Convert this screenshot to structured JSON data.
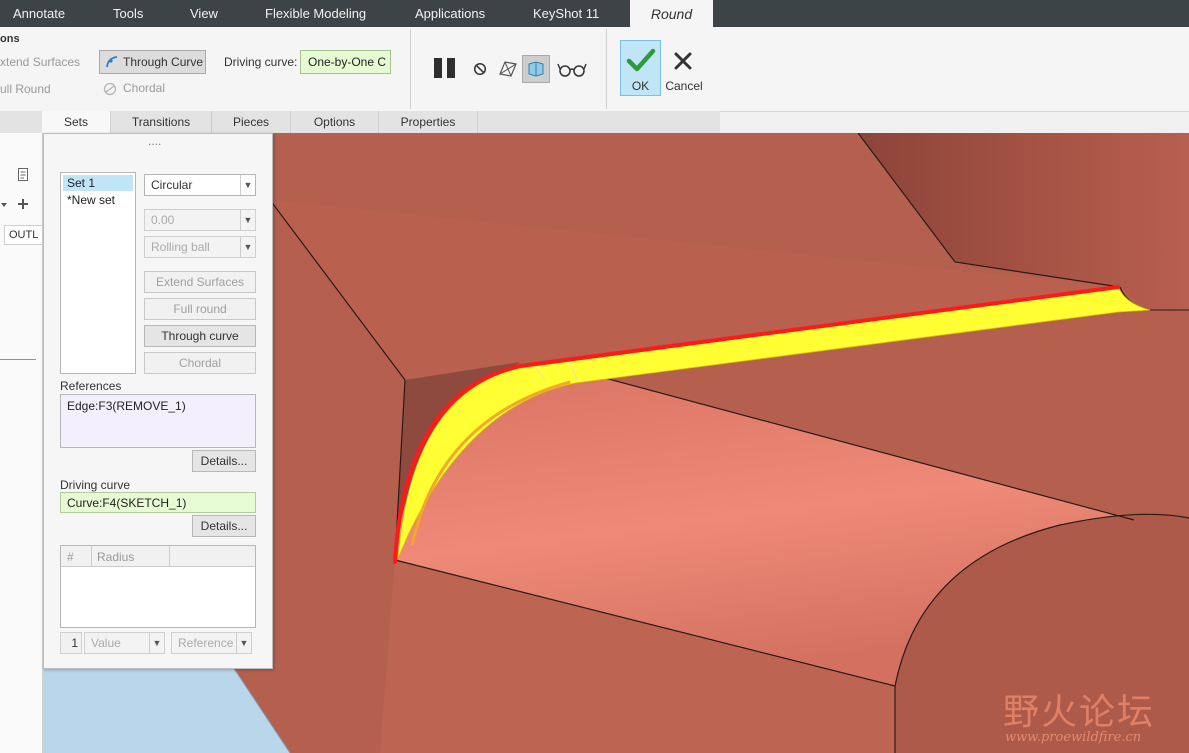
{
  "tabs": [
    "Annotate",
    "Tools",
    "View",
    "Flexible Modeling",
    "Applications",
    "KeyShot 11"
  ],
  "active_tab": "Round",
  "ribbon": {
    "group_title": "ons",
    "extend_surfaces": "xtend Surfaces",
    "full_round": "ull Round",
    "through_curve": "Through Curve",
    "chordal": "Chordal",
    "driving_curve_label": "Driving curve:",
    "driving_curve_value": "One-by-One C",
    "ok": "OK",
    "cancel": "Cancel"
  },
  "subtabs": [
    "Sets",
    "Transitions",
    "Pieces",
    "Options",
    "Properties"
  ],
  "leftstrip": {
    "column": "OUTL"
  },
  "panel": {
    "grip": "....",
    "sets": [
      "Set 1",
      "*New set"
    ],
    "shape": "Circular",
    "value": "0.00",
    "method": "Rolling ball",
    "buttons": {
      "extend": "Extend Surfaces",
      "full_round": "Full round",
      "through_curve": "Through curve",
      "chordal": "Chordal"
    },
    "references_label": "References",
    "references_value": "Edge:F3(REMOVE_1)",
    "details": "Details...",
    "driving_label": "Driving curve",
    "driving_value": "Curve:F4(SKETCH_1)",
    "table_headers": [
      "#",
      "Radius"
    ],
    "row_num": "1",
    "value_drop": "Value",
    "reference_drop": "Reference"
  },
  "watermark": {
    "cn": "野火论坛",
    "url": "www.proewildfire.cn"
  },
  "colors": {
    "accent_yellow": "#ffff33",
    "edge_red": "#ff1a1a",
    "ok_bg": "#bfe5f6"
  }
}
